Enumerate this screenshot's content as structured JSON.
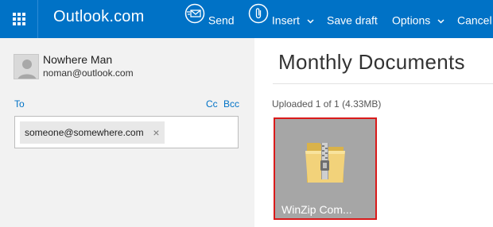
{
  "app": {
    "brand": "Outlook.com"
  },
  "toolbar": {
    "send_label": "Send",
    "insert_label": "Insert",
    "save_draft_label": "Save draft",
    "options_label": "Options",
    "cancel_label": "Cancel"
  },
  "compose": {
    "sender_name": "Nowhere Man",
    "sender_email": "noman@outlook.com",
    "to_label": "To",
    "cc_label": "Cc",
    "bcc_label": "Bcc",
    "recipients": [
      "someone@somewhere.com"
    ],
    "remove_glyph": "×"
  },
  "message": {
    "subject": "Monthly Documents",
    "upload_status": "Uploaded 1 of 1 (4.33MB)",
    "attachment_name": "WinZip Com..."
  },
  "colors": {
    "header_bg": "#0072c6",
    "link": "#0072c6",
    "selection_border": "#d91a1a",
    "pane_bg": "#f2f2f2"
  }
}
